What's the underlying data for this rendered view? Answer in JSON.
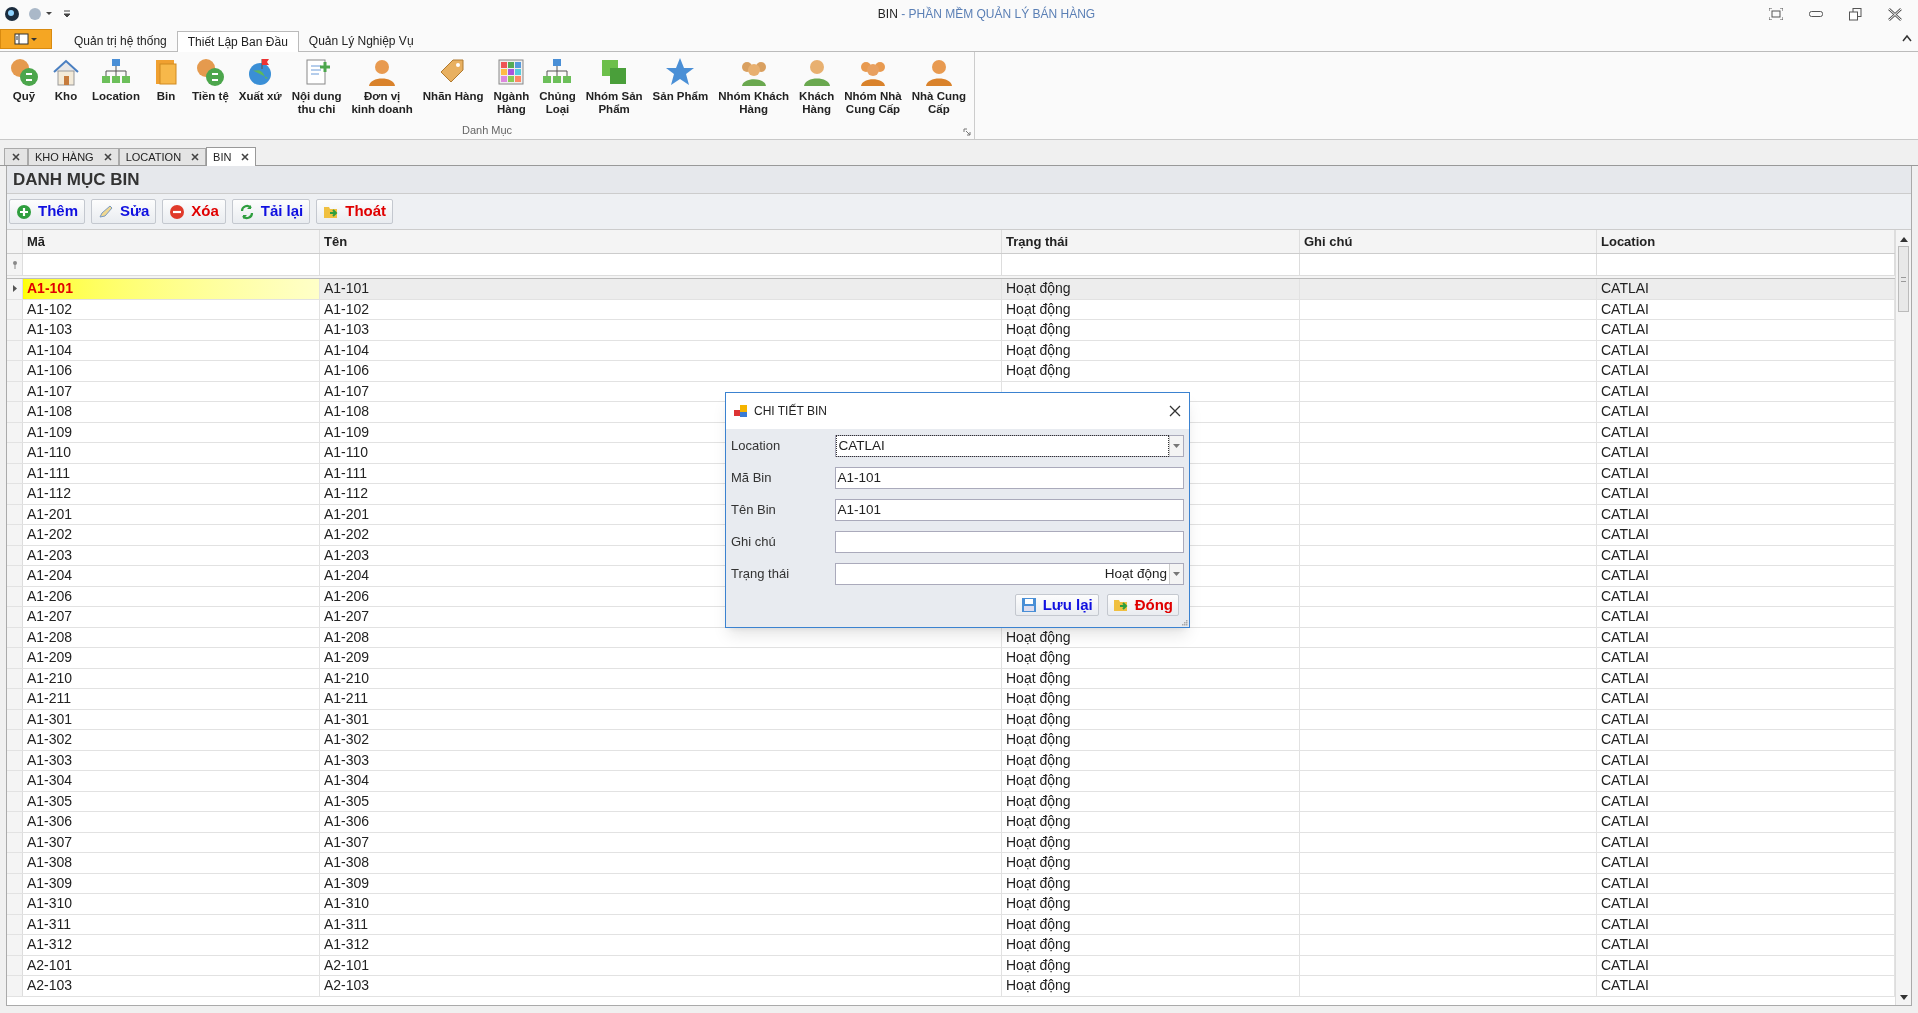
{
  "window": {
    "title_doc": "BIN",
    "title_app": "- PHẦN MỀM QUẢN LÝ BÁN HÀNG"
  },
  "ribbon_tabs": [
    {
      "label": "Quản trị hệ thống",
      "selected": false
    },
    {
      "label": "Thiết Lập Ban Đầu",
      "selected": true
    },
    {
      "label": "Quản Lý Nghiệp Vụ",
      "selected": false
    }
  ],
  "ribbon_group": {
    "title": "Danh Mục",
    "items": [
      {
        "label": "Quỹ"
      },
      {
        "label": "Kho"
      },
      {
        "label": "Location"
      },
      {
        "label": "Bin"
      },
      {
        "label": "Tiền tệ"
      },
      {
        "label": "Xuất xứ"
      },
      {
        "label": "Nội dung\nthu chi"
      },
      {
        "label": "Đơn vị\nkinh doanh"
      },
      {
        "label": "Nhãn Hàng"
      },
      {
        "label": "Ngành\nHàng"
      },
      {
        "label": "Chủng\nLoại"
      },
      {
        "label": "Nhóm Sản\nPhẩm"
      },
      {
        "label": "Sản Phẩm"
      },
      {
        "label": "Nhóm Khách\nHàng"
      },
      {
        "label": "Khách\nHàng"
      },
      {
        "label": "Nhóm Nhà\nCung Cấp"
      },
      {
        "label": "Nhà Cung\nCấp"
      }
    ]
  },
  "doc_tabs": [
    {
      "label": "KHO HÀNG",
      "selected": false
    },
    {
      "label": "LOCATION",
      "selected": false
    },
    {
      "label": "BIN",
      "selected": true
    }
  ],
  "panel_title": "DANH MỤC BIN",
  "toolbar": [
    {
      "label": "Thêm",
      "kind": "add"
    },
    {
      "label": "Sửa",
      "kind": "edit"
    },
    {
      "label": "Xóa",
      "kind": "delete"
    },
    {
      "label": "Tải lại",
      "kind": "reload"
    },
    {
      "label": "Thoát",
      "kind": "exit"
    }
  ],
  "table": {
    "columns": [
      "Mã",
      "Tên",
      "Trạng thái",
      "Ghi chú",
      "Location"
    ],
    "rows": [
      {
        "code": "A1-101",
        "name": "A1-101",
        "status": "Hoạt động",
        "location": "CATLAI",
        "selected": true
      },
      {
        "code": "A1-102",
        "name": "A1-102",
        "status": "Hoạt động",
        "location": "CATLAI",
        "selected": false
      },
      {
        "code": "A1-103",
        "name": "A1-103",
        "status": "Hoạt động",
        "location": "CATLAI",
        "selected": false
      },
      {
        "code": "A1-104",
        "name": "A1-104",
        "status": "Hoạt động",
        "location": "CATLAI",
        "selected": false
      },
      {
        "code": "A1-106",
        "name": "A1-106",
        "status": "Hoạt động",
        "location": "CATLAI",
        "selected": false
      },
      {
        "code": "A1-107",
        "name": "A1-107",
        "location": "CATLAI",
        "selected": false
      },
      {
        "code": "A1-108",
        "name": "A1-108",
        "location": "CATLAI",
        "selected": false
      },
      {
        "code": "A1-109",
        "name": "A1-109",
        "location": "CATLAI",
        "selected": false
      },
      {
        "code": "A1-110",
        "name": "A1-110",
        "location": "CATLAI",
        "selected": false
      },
      {
        "code": "A1-111",
        "name": "A1-111",
        "location": "CATLAI",
        "selected": false
      },
      {
        "code": "A1-112",
        "name": "A1-112",
        "location": "CATLAI",
        "selected": false
      },
      {
        "code": "A1-201",
        "name": "A1-201",
        "location": "CATLAI",
        "selected": false
      },
      {
        "code": "A1-202",
        "name": "A1-202",
        "location": "CATLAI",
        "selected": false
      },
      {
        "code": "A1-203",
        "name": "A1-203",
        "location": "CATLAI",
        "selected": false
      },
      {
        "code": "A1-204",
        "name": "A1-204",
        "location": "CATLAI",
        "selected": false
      },
      {
        "code": "A1-206",
        "name": "A1-206",
        "location": "CATLAI",
        "selected": false
      },
      {
        "code": "A1-207",
        "name": "A1-207",
        "location": "CATLAI",
        "selected": false
      },
      {
        "code": "A1-208",
        "name": "A1-208",
        "status": "Hoạt động",
        "location": "CATLAI",
        "selected": false
      },
      {
        "code": "A1-209",
        "name": "A1-209",
        "status": "Hoạt động",
        "location": "CATLAI",
        "selected": false
      },
      {
        "code": "A1-210",
        "name": "A1-210",
        "status": "Hoạt động",
        "location": "CATLAI",
        "selected": false
      },
      {
        "code": "A1-211",
        "name": "A1-211",
        "status": "Hoạt động",
        "location": "CATLAI",
        "selected": false
      },
      {
        "code": "A1-301",
        "name": "A1-301",
        "status": "Hoạt động",
        "location": "CATLAI",
        "selected": false
      },
      {
        "code": "A1-302",
        "name": "A1-302",
        "status": "Hoạt động",
        "location": "CATLAI",
        "selected": false
      },
      {
        "code": "A1-303",
        "name": "A1-303",
        "status": "Hoạt động",
        "location": "CATLAI",
        "selected": false
      },
      {
        "code": "A1-304",
        "name": "A1-304",
        "status": "Hoạt động",
        "location": "CATLAI",
        "selected": false
      },
      {
        "code": "A1-305",
        "name": "A1-305",
        "status": "Hoạt động",
        "location": "CATLAI",
        "selected": false
      },
      {
        "code": "A1-306",
        "name": "A1-306",
        "status": "Hoạt động",
        "location": "CATLAI",
        "selected": false
      },
      {
        "code": "A1-307",
        "name": "A1-307",
        "status": "Hoạt động",
        "location": "CATLAI",
        "selected": false
      },
      {
        "code": "A1-308",
        "name": "A1-308",
        "status": "Hoạt động",
        "location": "CATLAI",
        "selected": false
      },
      {
        "code": "A1-309",
        "name": "A1-309",
        "status": "Hoạt động",
        "location": "CATLAI",
        "selected": false
      },
      {
        "code": "A1-310",
        "name": "A1-310",
        "status": "Hoạt động",
        "location": "CATLAI",
        "selected": false
      },
      {
        "code": "A1-311",
        "name": "A1-311",
        "status": "Hoạt động",
        "location": "CATLAI",
        "selected": false
      },
      {
        "code": "A1-312",
        "name": "A1-312",
        "status": "Hoạt động",
        "location": "CATLAI",
        "selected": false
      },
      {
        "code": "A2-101",
        "name": "A2-101",
        "status": "Hoạt động",
        "location": "CATLAI",
        "selected": false
      },
      {
        "code": "A2-103",
        "name": "A2-103",
        "status": "Hoạt động",
        "location": "CATLAI",
        "selected": false
      }
    ]
  },
  "dialog": {
    "title": "CHI TIẾT BIN",
    "fields": [
      {
        "label": "Location",
        "kind": "dropdown",
        "value": "CATLAI"
      },
      {
        "label": "Mã Bin",
        "kind": "text",
        "value": "A1-101"
      },
      {
        "label": "Tên Bin",
        "kind": "text",
        "value": "A1-101"
      },
      {
        "label": "Ghi chú",
        "kind": "text"
      },
      {
        "label": "Trạng thái",
        "kind": "status",
        "value": "Hoạt động"
      }
    ],
    "buttons": [
      {
        "label": "Lưu lại",
        "kind": "save"
      },
      {
        "label": "Đóng",
        "kind": "close"
      }
    ]
  }
}
